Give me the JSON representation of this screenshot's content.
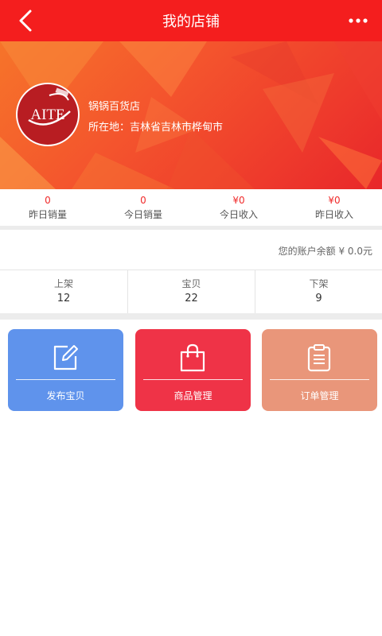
{
  "header": {
    "title": "我的店铺",
    "back_icon": "back-arrow-icon",
    "more_icon": "more-dots-icon",
    "color": "#f41e1e"
  },
  "shop": {
    "name": "锅锅百货店",
    "location": "所在地：吉林省吉林市桦甸市",
    "logo_text": "AITE"
  },
  "stats": [
    {
      "value": "0",
      "label": "昨日销量"
    },
    {
      "value": "0",
      "label": "今日销量"
    },
    {
      "value": "¥0",
      "label": "今日收入"
    },
    {
      "value": "¥0",
      "label": "昨日收入"
    }
  ],
  "balance": {
    "text": "您的账户余额  ¥  0.0元"
  },
  "counts": [
    {
      "label": "上架",
      "value": "12"
    },
    {
      "label": "宝贝",
      "value": "22"
    },
    {
      "label": "下架",
      "value": "9"
    }
  ],
  "actions": [
    {
      "label": "发布宝贝",
      "icon": "edit-icon",
      "color": "#5f93ec"
    },
    {
      "label": "商品管理",
      "icon": "shopping-bag-icon",
      "color": "#ef3347"
    },
    {
      "label": "订单管理",
      "icon": "clipboard-icon",
      "color": "#e9967a"
    }
  ]
}
